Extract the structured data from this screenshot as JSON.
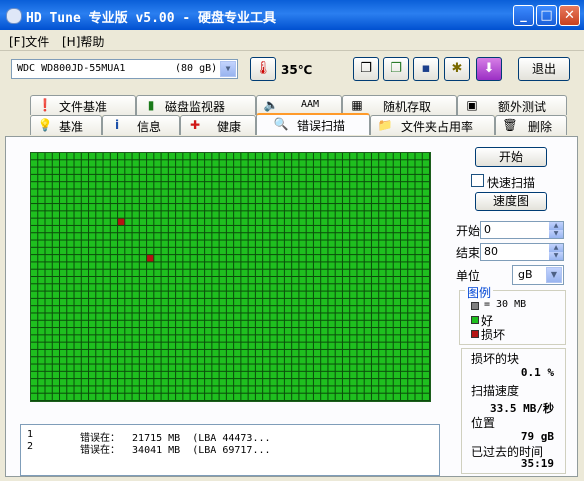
{
  "window": {
    "title": "HD Tune 专业版 v5.00 - 硬盘专业工具",
    "buttons": {
      "minimize": "_",
      "maximize": "□",
      "close": "✕"
    }
  },
  "menu": {
    "items": [
      "[F]文件",
      "[H]帮助"
    ]
  },
  "toolbar": {
    "drive": "WDC WD800JD-55MUA1",
    "drive_size": "(80 gB)",
    "temperature": "35℃",
    "exit_label": "退出"
  },
  "tabs": {
    "row_back": [
      "文件基准",
      "磁盘监视器",
      "AAM",
      "随机存取",
      "额外测试"
    ],
    "row_front": [
      "基准",
      "信息",
      "健康",
      "错误扫描",
      "文件夹占用率",
      "删除"
    ],
    "active": "错误扫描"
  },
  "scan": {
    "grid_cols": 55,
    "grid_rows": 34,
    "damaged_blocks": [
      {
        "col": 12,
        "row": 9
      },
      {
        "col": 16,
        "row": 14
      }
    ],
    "colors": {
      "good": "#1fbf1f",
      "damaged": "#b41414",
      "grid_line": "#0b4d0b"
    }
  },
  "log": {
    "rows": [
      {
        "index": "1",
        "text": "错误在：  21715 MB  (LBA 44473..."
      },
      {
        "index": "2",
        "text": "错误在：  34041 MB  (LBA 69717..."
      }
    ]
  },
  "controls": {
    "start_label": "开始",
    "quick_scan_label": "快速扫描",
    "quick_scan_checked": false,
    "speed_map_label": "速度图",
    "start_field_label": "开始",
    "start_value": "0",
    "end_field_label": "结束",
    "end_value": "80",
    "unit_label": "单位",
    "unit_value": "gB"
  },
  "legend": {
    "title": "图例",
    "items": [
      {
        "label": "= 30 MB",
        "color": "#808080"
      },
      {
        "label": "好",
        "color": "#1fbf1f"
      },
      {
        "label": "损坏",
        "color": "#b41414"
      }
    ]
  },
  "stats": {
    "damaged_label": "损坏的块",
    "damaged_value": "0.1 %",
    "speed_label": "扫描速度",
    "speed_value": "33.5 MB/秒",
    "position_label": "位置",
    "position_value": "79 gB",
    "elapsed_label": "已过去的时间",
    "elapsed_value": "35:19"
  }
}
